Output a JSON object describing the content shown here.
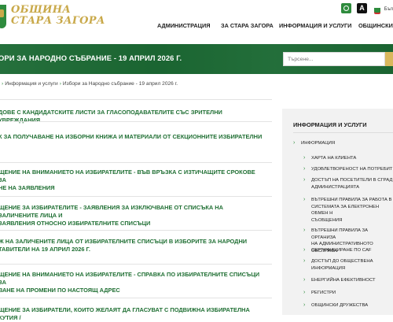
{
  "header": {
    "logo_line1": "ОБЩИНА",
    "logo_line2": "СТАРА ЗАГОРА",
    "lang_label": "Бъл",
    "accessibility_label": "A",
    "nav": [
      "АДМИНИСТРАЦИЯ",
      "ЗА СТАРА ЗАГОРА",
      "ИНФОРМАЦИЯ И УСЛУГИ",
      "ОБЩИНСКИ"
    ]
  },
  "hero": {
    "title": "ОРИ ЗА НАРОДНО СЪБРАНИЕ - 19 АПРИЛ 2026 Г.",
    "search_placeholder": "Търсене..."
  },
  "breadcrumb": {
    "items": [
      "Информация и услуги",
      "Избори за Народно събрание - 19 април 2026 г."
    ]
  },
  "list_items": [
    "ДОВЕ С КАНДИДАТСКИТЕ ЛИСТИ ЗА ГЛАСОПОДАВАТЕЛИТЕ СЪС ЗРИТЕЛНИ УВРЕЖДАНИЯ",
    "К ЗА ПОЛУЧАВАНЕ НА ИЗБОРНИ КНИЖА И МАТЕРИАЛИ ОТ СЕКЦИОННИТЕ ИЗБИРАТЕЛНИ",
    "ЩЕНИЕ НА ВНИМАНИЕТО НА ИЗБИРАТЕЛИТЕ - ВЪВ ВРЪЗКА С ИЗТИЧАЩИТЕ СРОКОВЕ ЗА",
    "ЩЕНИЕ ЗА ИЗБИРАТЕЛИТЕ - ЗАЯВЛЕНИЯ ЗА ИЗКЛЮЧВАНЕ ОТ СПИСЪКА НА ЗАЛИЧЕНИТЕ ЛИЦА И",
    "Ж НА ЗАЛИЧЕНИТЕ ЛИЦА ОТ ИЗБИРАТЕЛНИТЕ СПИСЪЦИ В ИЗБОРИТЕ ЗА НАРОДНИ",
    "ЩЕНИЕ НА ВНИМАНИЕТО НА ИЗБИРАТЕЛИТЕ - СПРАВКА ПО ИЗБИРАТЕЛНИТЕ СПИСЪЦИ ЗА",
    "ЩЕНИЕ ЗА ИЗБИРАТЕЛИ, КОИТО ЖЕЛАЯТ ДА ГЛАСУВАТ С ПОДВИЖНА ИЗБИРАТЕЛНА КУТИЯ /"
  ],
  "list_items_line2": [
    "",
    "",
    "НЕ НА ЗАЯВЛЕНИЯ",
    "ЗАЯВЛЕНИЯ ОТНОСНО ИЗБИРАТЕЛНИТЕ СПИСЪЦИ",
    "ТАВИТЕЛИ НА 19 АПРИЛ 2026 Г.",
    "ВАНЕ НА ПРОМЕНИ ПО НАСТОЯЩ АДРЕС",
    ""
  ],
  "sidebar": {
    "heading": "ИНФОРМАЦИЯ И УСЛУГИ",
    "items": [
      {
        "lines": [
          "ИНФОРМАЦИЯ"
        ],
        "level": 1
      },
      {
        "lines": [
          "ХАРТА НА КЛИЕНТА"
        ],
        "level": 2
      },
      {
        "lines": [
          "УДОВЛЕТВОРЕНОСТ НА ПОТРЕБИТ"
        ],
        "level": 2
      },
      {
        "lines": [
          "ДОСТЪП НА ПОСЕТИТЕЛИ В СГРАД",
          "АДМИНИСТРАЦИЯТА"
        ],
        "level": 2
      },
      {
        "lines": [
          "ВЪТРЕШНИ ПРАВИЛА ЗА РАБОТА В",
          "СИСТЕМАТА ЗА ЕЛЕКТРОНЕН ОБМЕН Н",
          "СЪОБЩЕНИЯ"
        ],
        "level": 2
      },
      {
        "lines": [
          "ВЪТРЕШНИ ПРАВИЛА ЗА ОРГАНИЗА",
          "НА АДМИНИСТРАТИВНОТО ОБСЛУЖВА"
        ],
        "level": 2
      },
      {
        "lines": [
          "СЕРТИФИЦИРАНЕ ПО CAF"
        ],
        "level": 2
      },
      {
        "lines": [
          "ДОСТЪП ДО ОБЩЕСТВЕНА",
          "ИНФОРМАЦИЯ"
        ],
        "level": 2
      },
      {
        "lines": [
          "ЕНЕРГИЙНА ЕФЕКТИВНОСТ"
        ],
        "level": 2
      },
      {
        "lines": [
          "РЕГИСТРИ"
        ],
        "level": 2
      },
      {
        "lines": [
          "ОБЩИНСКИ ДРУЖЕСТВА"
        ],
        "level": 2
      }
    ]
  },
  "colors": {
    "brand_green": "#1c6a34",
    "link_green": "#1f6f33",
    "gold": "#c9a94a",
    "sidebar_bg": "#f2f2f2"
  }
}
